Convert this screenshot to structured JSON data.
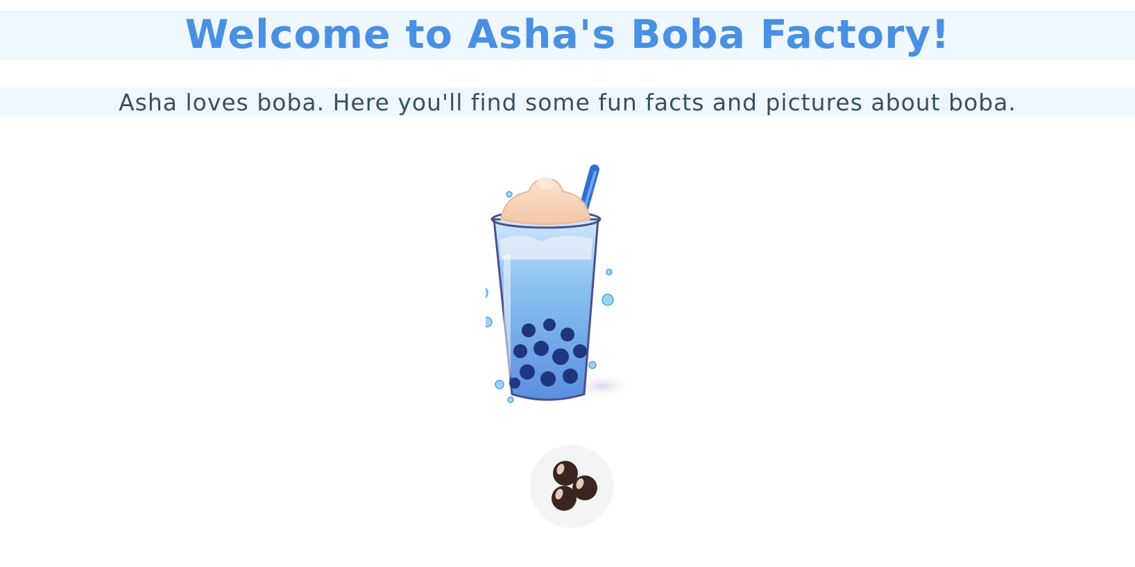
{
  "page": {
    "title": "Welcome to Asha's Boba Factory!",
    "subtitle": "Asha loves boba. Here you'll find some fun facts and pictures about boba."
  },
  "images": {
    "main": {
      "icon": "bubble-tea-cup-icon"
    },
    "button": {
      "icon": "boba-pearls-icon"
    }
  },
  "colors": {
    "title": "#4a90e2",
    "band": "#eef7fd",
    "subtitle_text": "#3b4d61",
    "button_bg": "#f4f4f4"
  }
}
